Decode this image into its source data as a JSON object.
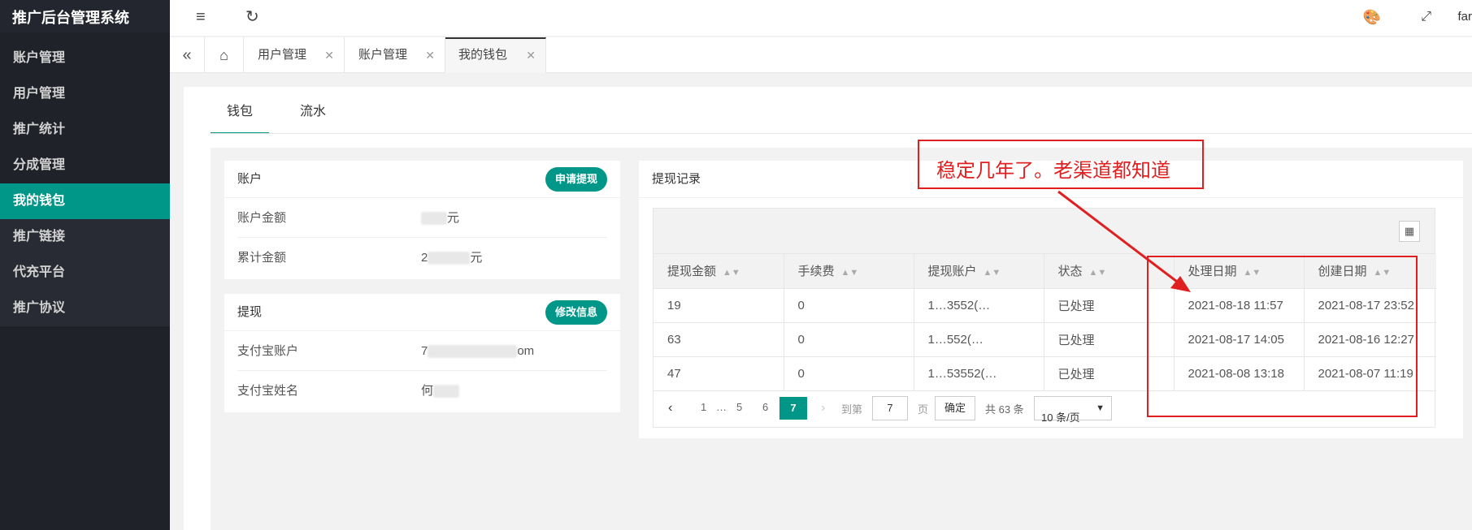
{
  "app": {
    "title": "推广后台管理系统",
    "user": "far"
  },
  "sidebar": {
    "items": [
      {
        "label": "账户管理"
      },
      {
        "label": "用户管理"
      },
      {
        "label": "推广统计"
      },
      {
        "label": "分成管理"
      },
      {
        "label": "我的钱包",
        "active": true
      },
      {
        "label": "推广链接"
      },
      {
        "label": "代充平台"
      },
      {
        "label": "推广协议"
      }
    ]
  },
  "tabs": [
    {
      "label": "用户管理"
    },
    {
      "label": "账户管理"
    },
    {
      "label": "我的钱包",
      "active": true
    }
  ],
  "subtabs": [
    {
      "label": "钱包",
      "active": true
    },
    {
      "label": "流水"
    }
  ],
  "account_card": {
    "title": "账户",
    "button": "申请提现",
    "rows": [
      {
        "label": "账户金额",
        "value_prefix": "",
        "value_suffix": "元"
      },
      {
        "label": "累计金额",
        "value_prefix": "2",
        "value_suffix": "元"
      }
    ]
  },
  "withdraw_card": {
    "title": "提现",
    "button": "修改信息",
    "rows": [
      {
        "label": "支付宝账户",
        "value_prefix": "7",
        "value_suffix": "om"
      },
      {
        "label": "支付宝姓名",
        "value_prefix": "何",
        "value_suffix": ""
      }
    ]
  },
  "records": {
    "title": "提现记录",
    "columns": [
      "提现金额",
      "手续费",
      "提现账户",
      "状态",
      "处理日期",
      "创建日期"
    ],
    "rows": [
      [
        "19",
        "0",
        "1…3552(…",
        "已处理",
        "2021-08-18 11:57",
        "2021-08-17 23:52"
      ],
      [
        "63",
        "0",
        "1…552(…",
        "已处理",
        "2021-08-17 14:05",
        "2021-08-16 12:27"
      ],
      [
        "47",
        "0",
        "1…53552(…",
        "已处理",
        "2021-08-08 13:18",
        "2021-08-07 11:19"
      ]
    ],
    "pager": {
      "pages": [
        "1",
        "…",
        "5",
        "6"
      ],
      "current": "7",
      "goto_label": "到第",
      "goto_value": "7",
      "page_unit": "页",
      "confirm": "确定",
      "total": "共 63 条",
      "page_size": "10 条/页"
    }
  },
  "annotation": {
    "text": "稳定几年了。老渠道都知道",
    "color": "#e02020"
  },
  "colors": {
    "accent": "#009688",
    "sidebar": "#20222a"
  }
}
